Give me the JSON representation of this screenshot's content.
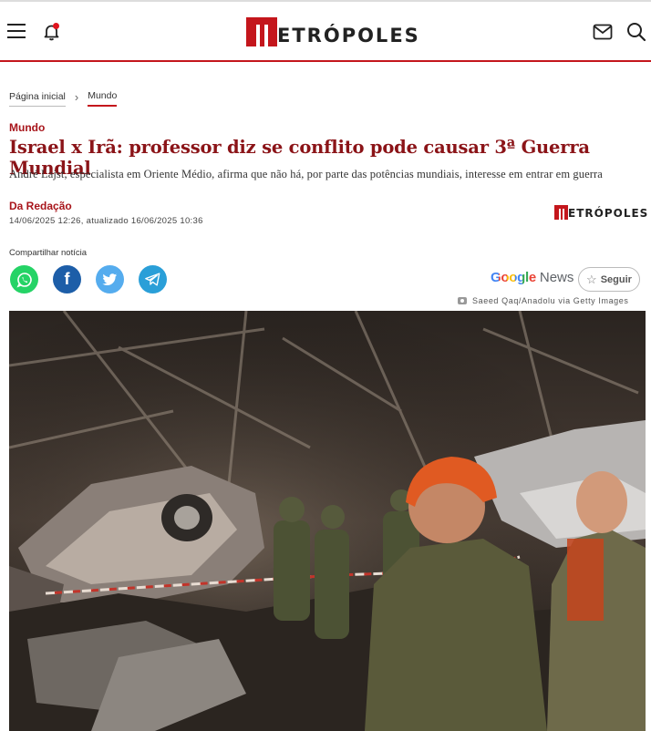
{
  "header": {
    "brand": "METRÓPOLES",
    "brand_rest": "ETRÓPOLES",
    "colors": {
      "accent": "#c4161c",
      "headline": "#8b1418"
    },
    "icons": [
      "menu-icon",
      "bell-icon",
      "mail-icon",
      "search-icon"
    ]
  },
  "breadcrumb": {
    "home": "Página inicial",
    "current": "Mundo"
  },
  "article": {
    "section": "Mundo",
    "headline": "Israel x Irã: professor diz se conflito pode causar 3ª Guerra Mundial",
    "subtitle": "André Lajst, especialista em Oriente Médio, afirma que não há, por parte das potências mundiais, interesse em entrar em guerra",
    "author": "Da Redação",
    "dates": "14/06/2025 12:26, atualizado 16/06/2025 10:36",
    "publisher_logo_text": "ETRÓPOLES"
  },
  "share": {
    "label": "Compartilhar notícia",
    "networks": [
      "whatsapp-icon",
      "facebook-icon",
      "twitter-icon",
      "telegram-icon"
    ],
    "facebook_glyph": "f"
  },
  "google_news": {
    "google": "Google",
    "news": "News",
    "follow": "Seguir",
    "star": "☆"
  },
  "photo": {
    "credit": "Saeed Qaq/Anadolu via Getty Images"
  }
}
